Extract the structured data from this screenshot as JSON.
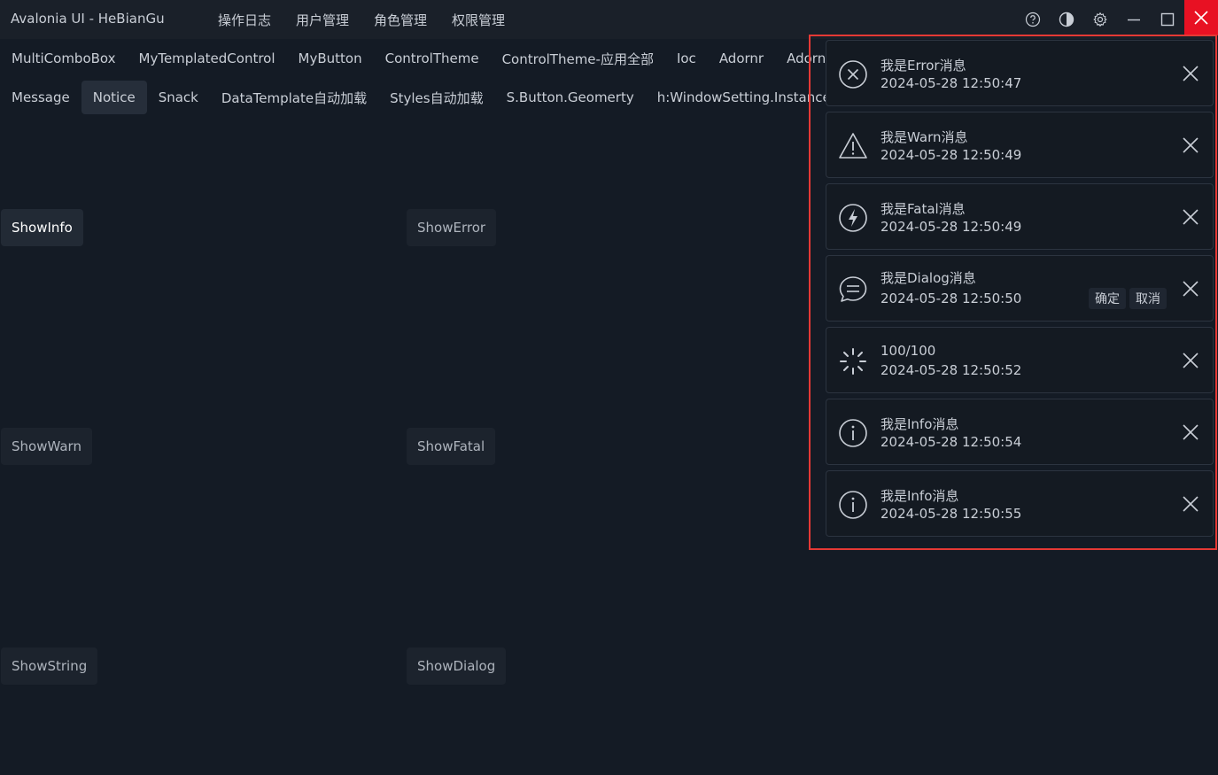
{
  "app": {
    "title": "Avalonia UI - HeBianGu"
  },
  "top_menu": [
    "操作日志",
    "用户管理",
    "角色管理",
    "权限管理"
  ],
  "window_controls": {
    "icons": [
      "help-icon",
      "theme-icon",
      "settings-icon",
      "minimize-icon",
      "maximize-icon",
      "close-icon"
    ],
    "close_color": "#e81123"
  },
  "tabs_row1": [
    "MultiComboBox",
    "MyTemplatedControl",
    "MyButton",
    "ControlTheme",
    "ControlTheme-应用全部",
    "Ioc",
    "Adornr",
    "Adornr"
  ],
  "tabs_row2": [
    "Message",
    "Notice",
    "Snack",
    "DataTemplate自动加载",
    "Styles自动加载",
    "S.Button.Geomerty",
    "h:WindowSetting.Instance"
  ],
  "active_tab": "Notice",
  "buttons": {
    "show_info": "ShowInfo",
    "show_error": "ShowError",
    "show_warn": "ShowWarn",
    "show_fatal": "ShowFatal",
    "show_string": "ShowString",
    "show_dialog": "ShowDialog"
  },
  "notices": [
    {
      "icon": "error-icon",
      "title": "我是Error消息",
      "time": "2024-05-28 12:50:47"
    },
    {
      "icon": "warning-icon",
      "title": "我是Warn消息",
      "time": "2024-05-28 12:50:49"
    },
    {
      "icon": "fatal-icon",
      "title": "我是Fatal消息",
      "time": "2024-05-28 12:50:49"
    },
    {
      "icon": "dialog-icon",
      "title": "我是Dialog消息",
      "time": "2024-05-28 12:50:50",
      "actions": [
        "确定",
        "取消"
      ]
    },
    {
      "icon": "loading-icon",
      "title": "100/100",
      "time": "2024-05-28 12:50:52"
    },
    {
      "icon": "info-icon",
      "title": "我是Info消息",
      "time": "2024-05-28 12:50:54"
    },
    {
      "icon": "info-icon",
      "title": "我是Info消息",
      "time": "2024-05-28 12:50:55"
    }
  ],
  "highlight_color": "#e53935"
}
